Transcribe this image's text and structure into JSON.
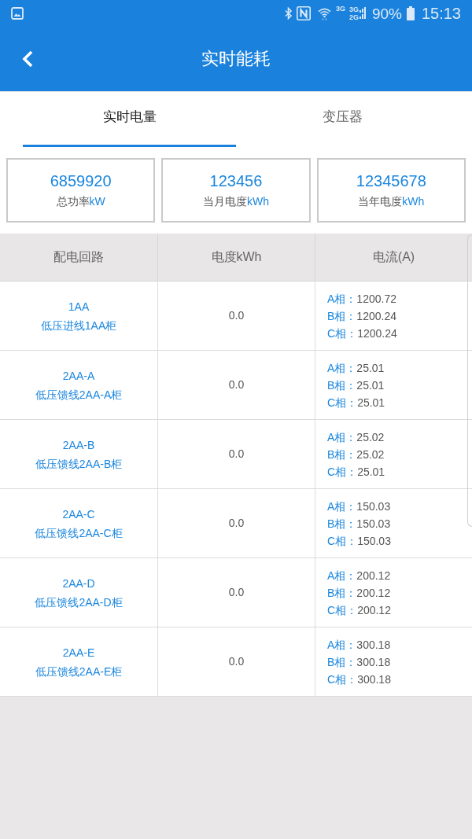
{
  "status_bar": {
    "network_wifi": "3G",
    "network_top": "3G",
    "network_bottom": "2G",
    "battery": "90%",
    "time": "15:13"
  },
  "app_bar": {
    "title": "实时能耗"
  },
  "tabs": [
    {
      "label": "实时电量",
      "selected": true
    },
    {
      "label": "变压器",
      "selected": false
    }
  ],
  "summary": [
    {
      "value": "6859920",
      "label": "总功率",
      "unit": "kW"
    },
    {
      "value": "123456",
      "label": "当月电度",
      "unit": "kWh"
    },
    {
      "value": "12345678",
      "label": "当年电度",
      "unit": "kWh"
    }
  ],
  "table": {
    "columns": [
      "配电回路",
      "电度kWh",
      "电流(A)"
    ],
    "rows": [
      {
        "code": "1AA",
        "name": "低压进线1AA柜",
        "energy": "0.0",
        "currents": [
          {
            "phase": "A相：",
            "value": "1200.72"
          },
          {
            "phase": "B相：",
            "value": "1200.24"
          },
          {
            "phase": "C相：",
            "value": "1200.24"
          }
        ]
      },
      {
        "code": "2AA-A",
        "name": "低压馈线2AA-A柜",
        "energy": "0.0",
        "currents": [
          {
            "phase": "A相：",
            "value": "25.01"
          },
          {
            "phase": "B相：",
            "value": "25.01"
          },
          {
            "phase": "C相：",
            "value": "25.01"
          }
        ]
      },
      {
        "code": "2AA-B",
        "name": "低压馈线2AA-B柜",
        "energy": "0.0",
        "currents": [
          {
            "phase": "A相：",
            "value": "25.02"
          },
          {
            "phase": "B相：",
            "value": "25.02"
          },
          {
            "phase": "C相：",
            "value": "25.01"
          }
        ]
      },
      {
        "code": "2AA-C",
        "name": "低压馈线2AA-C柜",
        "energy": "0.0",
        "currents": [
          {
            "phase": "A相：",
            "value": "150.03"
          },
          {
            "phase": "B相：",
            "value": "150.03"
          },
          {
            "phase": "C相：",
            "value": "150.03"
          }
        ]
      },
      {
        "code": "2AA-D",
        "name": "低压馈线2AA-D柜",
        "energy": "0.0",
        "currents": [
          {
            "phase": "A相：",
            "value": "200.12"
          },
          {
            "phase": "B相：",
            "value": "200.12"
          },
          {
            "phase": "C相：",
            "value": "200.12"
          }
        ]
      },
      {
        "code": "2AA-E",
        "name": "低压馈线2AA-E柜",
        "energy": "0.0",
        "currents": [
          {
            "phase": "A相：",
            "value": "300.18"
          },
          {
            "phase": "B相：",
            "value": "300.18"
          },
          {
            "phase": "C相：",
            "value": "300.18"
          }
        ]
      }
    ]
  }
}
